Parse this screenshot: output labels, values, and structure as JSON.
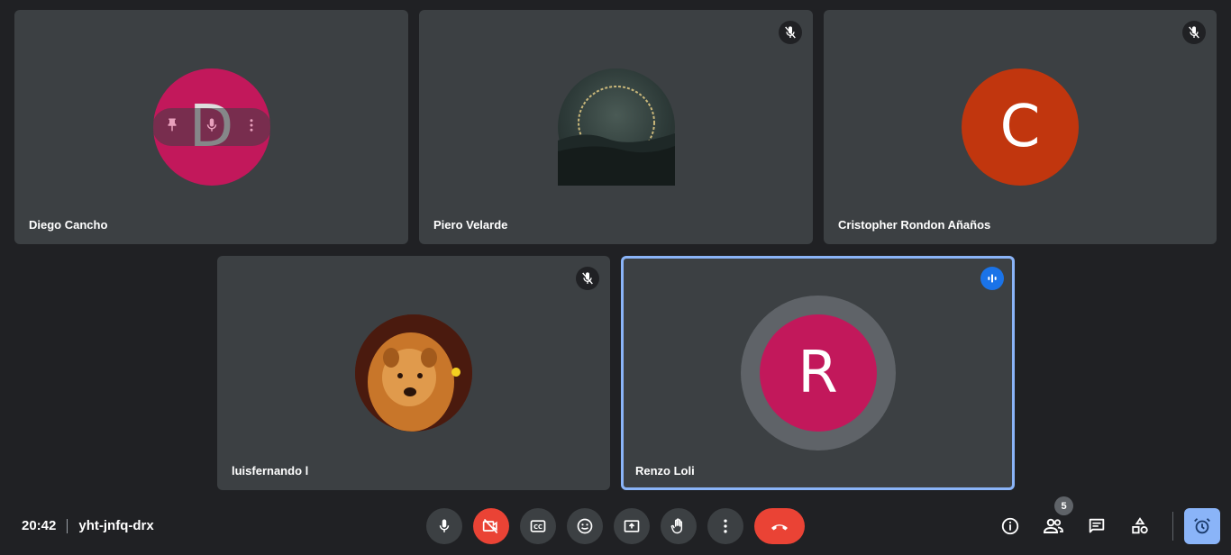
{
  "participants": [
    {
      "name": "Diego Cancho",
      "initial": "D",
      "avatar_color": "#c2185b",
      "muted": false,
      "hovered": true
    },
    {
      "name": "Piero Velarde",
      "initial": "",
      "avatar": "photo-ring-landscape",
      "muted": true
    },
    {
      "name": "Cristopher Rondon Añaños",
      "initial": "C",
      "avatar_color": "#c1360e",
      "muted": true
    },
    {
      "name": "luisfernando l",
      "initial": "",
      "avatar": "photo-dog",
      "muted": true
    },
    {
      "name": "Renzo Loli",
      "initial": "R",
      "avatar_color": "#c2185b",
      "speaking": true
    }
  ],
  "meeting": {
    "time": "20:42",
    "code": "yht-jnfq-drx"
  },
  "controls": [
    "mic",
    "camera-off",
    "captions",
    "emoji",
    "present",
    "raise-hand",
    "more-options",
    "leave-call"
  ],
  "right_controls": [
    "info",
    "people",
    "chat",
    "activities",
    "alarm"
  ],
  "people_count": "5",
  "colors": {
    "background": "#202124",
    "tile": "#3c4043",
    "accent": "#8ab4f8",
    "danger": "#ea4335"
  }
}
